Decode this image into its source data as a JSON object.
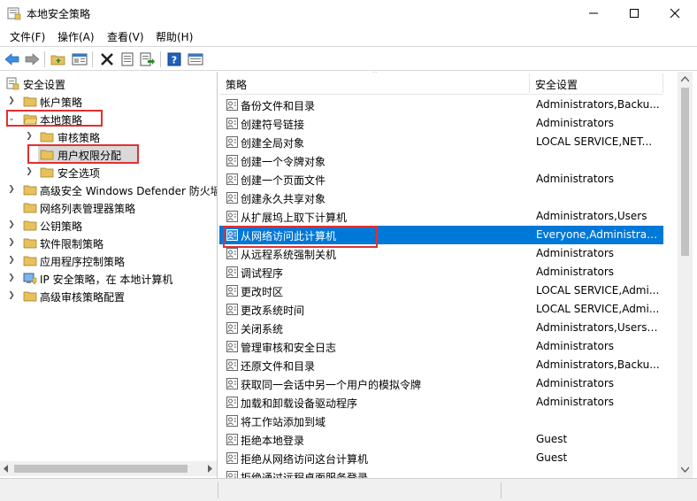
{
  "window": {
    "title": "本地安全策略",
    "minimize_glyph": "—",
    "maximize_glyph": "☐",
    "close_glyph": "✕"
  },
  "menu": [
    {
      "label": "文件(F)"
    },
    {
      "label": "操作(A)"
    },
    {
      "label": "查看(V)"
    },
    {
      "label": "帮助(H)"
    }
  ],
  "toolbar": {
    "icons": [
      "back-arrow-icon",
      "forward-arrow-icon",
      "up-folder-icon",
      "show-hide-tree-icon",
      "delete-icon",
      "properties-icon",
      "export-list-icon",
      "help-icon",
      "view-icon"
    ]
  },
  "tree": {
    "root": "安全设置",
    "items": [
      {
        "label": "帐户策略",
        "expanded": false
      },
      {
        "label": "本地策略",
        "expanded": true
      },
      {
        "label": "审核策略",
        "expanded": false
      },
      {
        "label": "用户权限分配",
        "selected": true
      },
      {
        "label": "安全选项",
        "expanded": false
      },
      {
        "label": "高级安全 Windows Defender 防火墙",
        "expanded": false
      },
      {
        "label": "网络列表管理器策略"
      },
      {
        "label": "公钥策略",
        "expanded": false
      },
      {
        "label": "软件限制策略",
        "expanded": false
      },
      {
        "label": "应用程序控制策略",
        "expanded": false
      },
      {
        "label": "IP 安全策略，在 本地计算机"
      },
      {
        "label": "高级审核策略配置",
        "expanded": false
      }
    ]
  },
  "list": {
    "columns": {
      "policy": "策略",
      "setting": "安全设置"
    },
    "rows": [
      {
        "name": "备份文件和目录",
        "setting": "Administrators,Backu..."
      },
      {
        "name": "创建符号链接",
        "setting": "Administrators"
      },
      {
        "name": "创建全局对象",
        "setting": "LOCAL SERVICE,NET..."
      },
      {
        "name": "创建一个令牌对象",
        "setting": ""
      },
      {
        "name": "创建一个页面文件",
        "setting": "Administrators"
      },
      {
        "name": "创建永久共享对象",
        "setting": ""
      },
      {
        "name": "从扩展坞上取下计算机",
        "setting": "Administrators,Users"
      },
      {
        "name": "从网络访问此计算机",
        "setting": "Everyone,Administrat...",
        "selected": true
      },
      {
        "name": "从远程系统强制关机",
        "setting": "Administrators"
      },
      {
        "name": "调试程序",
        "setting": "Administrators"
      },
      {
        "name": "更改时区",
        "setting": "LOCAL SERVICE,Admi..."
      },
      {
        "name": "更改系统时间",
        "setting": "LOCAL SERVICE,Admi..."
      },
      {
        "name": "关闭系统",
        "setting": "Administrators,Users,..."
      },
      {
        "name": "管理审核和安全日志",
        "setting": "Administrators"
      },
      {
        "name": "还原文件和目录",
        "setting": "Administrators,Backu..."
      },
      {
        "name": "获取同一会话中另一个用户的模拟令牌",
        "setting": "Administrators"
      },
      {
        "name": "加载和卸载设备驱动程序",
        "setting": "Administrators"
      },
      {
        "name": "将工作站添加到域",
        "setting": ""
      },
      {
        "name": "拒绝本地登录",
        "setting": "Guest"
      },
      {
        "name": "拒绝从网络访问这台计算机",
        "setting": "Guest"
      },
      {
        "name": "拒绝通过远程桌面服务登录",
        "setting": ""
      }
    ]
  },
  "colors": {
    "selection": "#0078d7",
    "highlight_box": "#e23030",
    "folder": "#e8c15b"
  }
}
